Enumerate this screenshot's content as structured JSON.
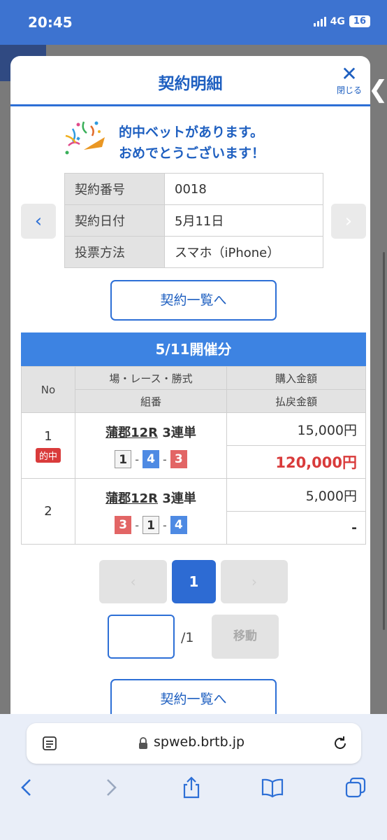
{
  "status_bar": {
    "time": "20:45",
    "network": "4G",
    "battery": "16"
  },
  "modal": {
    "title": "契約明細",
    "close_label": "閉じる",
    "celebrate_line1": "的中ベットがあります。",
    "celebrate_line2": "おめでとうございます！",
    "info": [
      {
        "label": "契約番号",
        "value": "0018"
      },
      {
        "label": "契約日付",
        "value": "5月11日"
      },
      {
        "label": "投票方法",
        "value": "スマホ（iPhone）"
      }
    ],
    "list_button": "契約一覧へ",
    "session_header": "5/11開催分",
    "table_headers": {
      "no": "No",
      "race": "場・レース・勝式",
      "purchase": "購入金額",
      "combo": "組番",
      "payout": "払戻金額"
    },
    "bets": [
      {
        "no": "1",
        "hit": "的中",
        "venue": "蒲郡12R",
        "bet_type": "3連単",
        "combo": [
          "1",
          "4",
          "3"
        ],
        "purchase": "15,000円",
        "payout": "120,000円"
      },
      {
        "no": "2",
        "venue": "蒲郡12R",
        "bet_type": "3連単",
        "combo": [
          "3",
          "1",
          "4"
        ],
        "purchase": "5,000円",
        "payout": "-"
      }
    ],
    "pager": {
      "prev": "‹",
      "current": "1",
      "next": "›",
      "total": "/1",
      "move": "移動",
      "page_input_value": ""
    },
    "list_button_bottom": "契約一覧へ"
  },
  "safari": {
    "url": "spweb.brtb.jp"
  },
  "colors": {
    "accent": "#2d6fd6",
    "header_bar": "#3d83e2",
    "hit_red": "#d93b3b",
    "boat_3": "#e26565",
    "boat_4": "#4e8ae3"
  }
}
